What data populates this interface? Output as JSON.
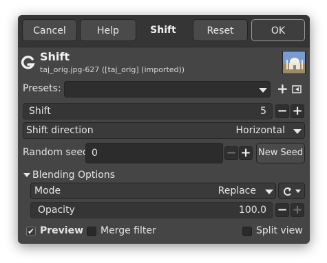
{
  "buttons": {
    "cancel": "Cancel",
    "help": "Help",
    "reset": "Reset",
    "ok": "OK"
  },
  "title_tab": "Shift",
  "header": {
    "title": "Shift",
    "subtitle": "taj_orig.jpg-627 ([taj_orig] (imported))",
    "logo": "gegl-logo-icon"
  },
  "presets": {
    "label": "Presets:",
    "value": ""
  },
  "shift": {
    "label": "Shift",
    "value": "5"
  },
  "shift_direction": {
    "label": "Shift direction",
    "value": "Horizontal"
  },
  "random_seed": {
    "label": "Random seed",
    "value": "0",
    "new_seed": "New Seed"
  },
  "blending": {
    "label": "Blending Options",
    "mode_label": "Mode",
    "mode_value": "Replace",
    "opacity_label": "Opacity",
    "opacity_value": "100.0"
  },
  "footer": {
    "preview": "Preview",
    "preview_checked": true,
    "merge": "Merge filter",
    "split": "Split view"
  },
  "icons": {
    "add": "plus-icon",
    "menu": "preset-menu-icon",
    "expander": "triangle-down-icon",
    "composite": "composite-mode-icon"
  }
}
